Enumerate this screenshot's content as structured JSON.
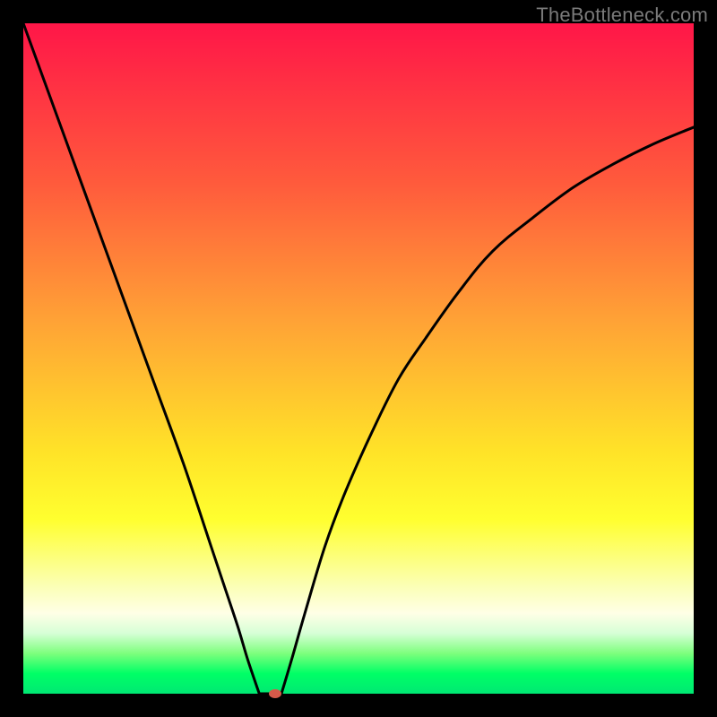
{
  "watermark": "TheBottleneck.com",
  "chart_data": {
    "type": "line",
    "title": "",
    "xlabel": "",
    "ylabel": "",
    "xlim": [
      0,
      100
    ],
    "ylim": [
      0,
      100
    ],
    "grid": false,
    "legend": false,
    "marker": {
      "x": 37.5,
      "y": 0,
      "color": "#d65a4a"
    },
    "series": [
      {
        "name": "bottleneck-left",
        "x": [
          0,
          4,
          8,
          12,
          16,
          20,
          24,
          28,
          30,
          32,
          33.5,
          35.2
        ],
        "y": [
          100,
          89,
          78,
          67,
          56,
          45,
          34,
          22,
          16,
          10,
          5,
          0
        ]
      },
      {
        "name": "bottleneck-flat",
        "x": [
          35.2,
          38.5
        ],
        "y": [
          0,
          0
        ]
      },
      {
        "name": "bottleneck-right",
        "x": [
          38.5,
          40,
          42,
          45,
          48,
          52,
          56,
          60,
          65,
          70,
          76,
          82,
          88,
          94,
          100
        ],
        "y": [
          0,
          5,
          12,
          22,
          30,
          39,
          47,
          53,
          60,
          66,
          71,
          75.5,
          79,
          82,
          84.5
        ]
      }
    ],
    "background_gradient": {
      "orientation": "vertical",
      "stops": [
        {
          "pos": 0.0,
          "color": "#ff1648"
        },
        {
          "pos": 0.24,
          "color": "#ff5b3c"
        },
        {
          "pos": 0.44,
          "color": "#ffa136"
        },
        {
          "pos": 0.64,
          "color": "#ffe328"
        },
        {
          "pos": 0.74,
          "color": "#ffff2f"
        },
        {
          "pos": 0.84,
          "color": "#fbffb6"
        },
        {
          "pos": 0.88,
          "color": "#ffffe6"
        },
        {
          "pos": 0.91,
          "color": "#d6ffd6"
        },
        {
          "pos": 0.94,
          "color": "#7dff7d"
        },
        {
          "pos": 0.97,
          "color": "#00ff66"
        },
        {
          "pos": 1.0,
          "color": "#00e873"
        }
      ]
    }
  }
}
